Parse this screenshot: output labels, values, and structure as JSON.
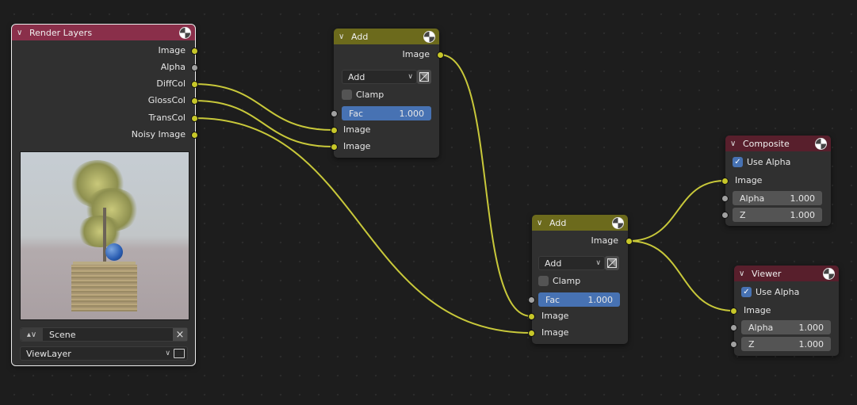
{
  "render_layers": {
    "title": "Render Layers",
    "outputs": [
      "Image",
      "Alpha",
      "DiffCol",
      "GlossCol",
      "TransCol",
      "Noisy Image"
    ],
    "scene": "Scene",
    "view_layer": "ViewLayer"
  },
  "add1": {
    "title": "Add",
    "output": "Image",
    "blend_mode": "Add",
    "clamp_label": "Clamp",
    "clamp_checked": false,
    "fac_label": "Fac",
    "fac_value": "1.000",
    "input1": "Image",
    "input2": "Image"
  },
  "add2": {
    "title": "Add",
    "output": "Image",
    "blend_mode": "Add",
    "clamp_label": "Clamp",
    "clamp_checked": false,
    "fac_label": "Fac",
    "fac_value": "1.000",
    "input1": "Image",
    "input2": "Image"
  },
  "composite": {
    "title": "Composite",
    "use_alpha_label": "Use Alpha",
    "use_alpha_checked": true,
    "input_image": "Image",
    "alpha_label": "Alpha",
    "alpha_value": "1.000",
    "z_label": "Z",
    "z_value": "1.000"
  },
  "viewer": {
    "title": "Viewer",
    "use_alpha_label": "Use Alpha",
    "use_alpha_checked": true,
    "input_image": "Image",
    "alpha_label": "Alpha",
    "alpha_value": "1.000",
    "z_label": "Z",
    "z_value": "1.000"
  },
  "colors": {
    "background": "#1d1d1d",
    "node_body": "#303030",
    "header_mix": "#6c6a1c",
    "header_input": "#8a2f4a",
    "header_output": "#581f2c",
    "socket_color": "#c7c729",
    "socket_value": "#a1a1a1",
    "wire": "#c8c83a",
    "accent_blue": "#4772b3"
  },
  "icons": {
    "collapse": "chevron-down-icon",
    "preview": "node-preview-icon",
    "scene": "scene-icon",
    "clear": "close-icon",
    "browse": "browse-icon",
    "color_picker": "color-picker-icon",
    "checkbox": "checkmark-icon"
  }
}
